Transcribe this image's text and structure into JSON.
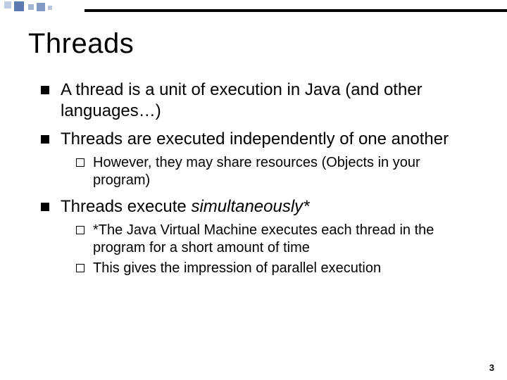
{
  "title": "Threads",
  "bullets": {
    "b1": "A thread is a unit of execution in Java (and other languages…)",
    "b2": "Threads are executed independently of one another",
    "b2_sub1_lead": "However, ",
    "b2_sub1_rest": "they may share resources (Objects in your program)",
    "b3_lead": "Threads execute ",
    "b3_italic": "simultaneously*",
    "b3_sub1_lead": "*The ",
    "b3_sub1_rest": "Java Virtual Machine executes each thread in the program for a short amount of time",
    "b3_sub2_lead": "This ",
    "b3_sub2_rest": "gives the impression of parallel execution"
  },
  "page_number": "3"
}
